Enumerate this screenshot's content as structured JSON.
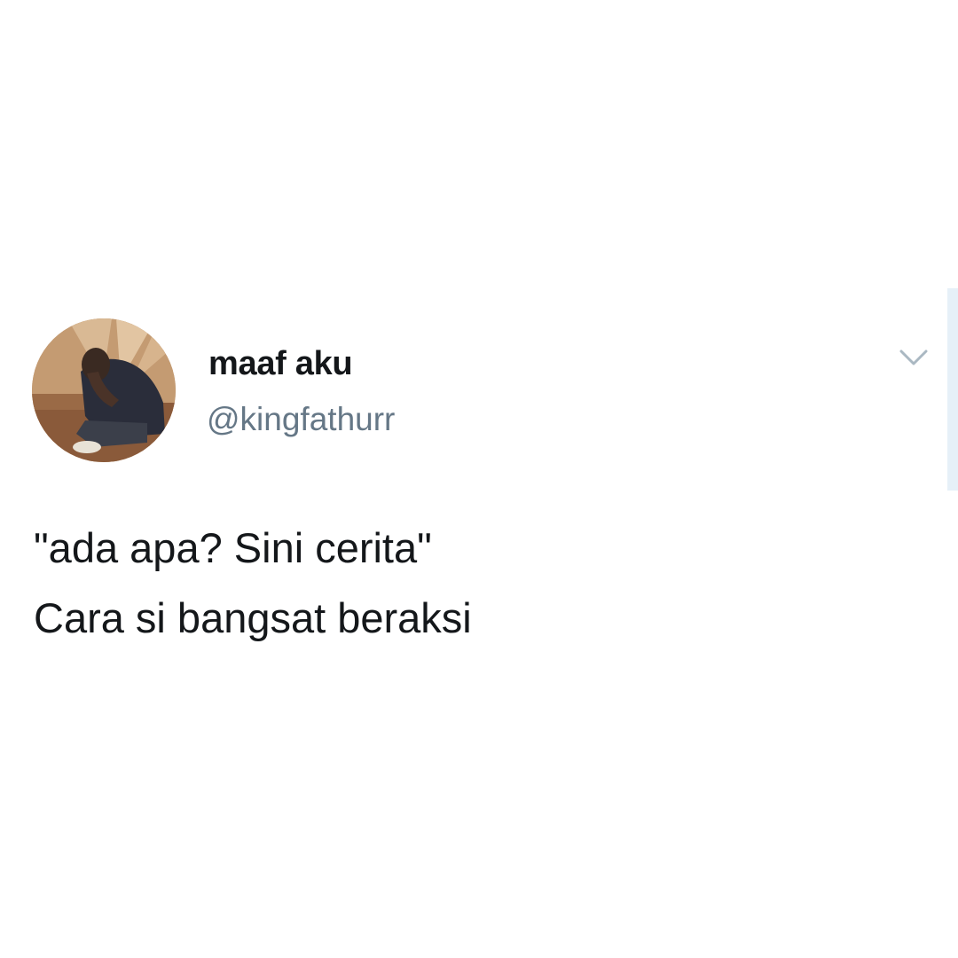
{
  "tweet": {
    "author": {
      "display_name": "maaf aku",
      "handle": "@kingfathurr",
      "avatar_icon": "profile-photo"
    },
    "menu_icon": "chevron-down-icon",
    "text_lines": [
      "\"ada apa? Sini cerita\"",
      "Cara si bangsat beraksi"
    ]
  },
  "colors": {
    "background": "#ffffff",
    "name": "#14171a",
    "handle": "#657786",
    "text": "#14171a",
    "caret": "#aab8c2",
    "scrollbar": "#e6f0f8"
  }
}
